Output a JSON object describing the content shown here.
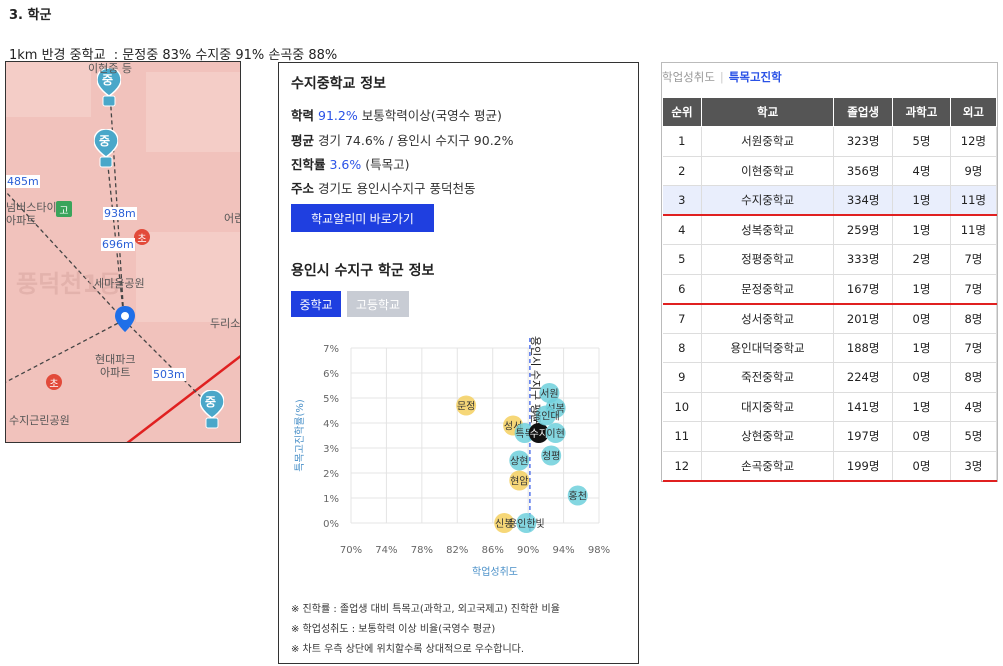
{
  "section_title": "3. 학군",
  "radius_summary": "1km 반경 중학교  : 문정중 83% 수지중 91% 손곡중 88%",
  "map": {
    "distances": [
      "485m",
      "938m",
      "696m",
      "503m"
    ],
    "labels": [
      "이현중 등",
      "아파트",
      "세마을공원",
      "풍덕천1동",
      "두리소",
      "현대파크",
      "아파트",
      "수지근린공원",
      "어린",
      "수지근린",
      "넘버스타이"
    ],
    "pin_labels": [
      "중",
      "중",
      "중"
    ],
    "badges": [
      "고",
      "초",
      "초"
    ],
    "icons": [
      "school-pin-icon",
      "location-pin-icon"
    ],
    "colors": {
      "area": "#f1c2bc",
      "road": "#e02020",
      "pin": "#4aa7c9",
      "location": "#1f6fe8"
    }
  },
  "school_info": {
    "title": "수지중학교 정보",
    "academic_label": "학력",
    "academic_value": "91.2%",
    "academic_note": "보통학력이상(국영수 평균)",
    "avg_label": "평균",
    "avg_value": "경기 74.6% / 용인시 수지구 90.2%",
    "advance_label": "진학률",
    "advance_value": "3.6%",
    "advance_note": "(특목고)",
    "address_label": "주소",
    "address_value": "경기도 용인시수지구 풍덕천동",
    "button": "학교알리미 바로가기"
  },
  "district": {
    "title": "용인시 수지구 학군 정보",
    "tabs": [
      "중학교",
      "고등학교"
    ],
    "active_tab": "중학교"
  },
  "chart_data": {
    "type": "scatter",
    "xlabel": "학업성취도",
    "ylabel": "특목고진학률(%)",
    "x_ticks": [
      "70%",
      "74%",
      "78%",
      "82%",
      "86%",
      "90%",
      "94%",
      "98%"
    ],
    "y_ticks": [
      "0%",
      "1%",
      "2%",
      "3%",
      "4%",
      "5%",
      "6%",
      "7%"
    ],
    "xlim": [
      70,
      98
    ],
    "ylim": [
      0,
      7
    ],
    "ref_line_label": "용인시 수지구 평균",
    "ref_line_x": 90.2,
    "points": [
      {
        "name": "문정",
        "x": 83.0,
        "y": 4.7,
        "color": "#f5d060"
      },
      {
        "name": "성서",
        "x": 88.3,
        "y": 3.9,
        "color": "#f5d060"
      },
      {
        "name": "현암",
        "x": 89.0,
        "y": 1.7,
        "color": "#f5d060"
      },
      {
        "name": "신봉",
        "x": 87.3,
        "y": 0.0,
        "color": "#f5d060"
      },
      {
        "name": "특목",
        "x": 89.6,
        "y": 3.6,
        "color": "#6fd0dc"
      },
      {
        "name": "수지",
        "x": 91.2,
        "y": 3.6,
        "color": "#111111"
      },
      {
        "name": "서원",
        "x": 92.4,
        "y": 5.2,
        "color": "#6fd0dc"
      },
      {
        "name": "성복",
        "x": 93.1,
        "y": 4.6,
        "color": "#6fd0dc"
      },
      {
        "name": "용인대",
        "x": 92.0,
        "y": 4.3,
        "color": "#6fd0dc"
      },
      {
        "name": "이현",
        "x": 93.1,
        "y": 3.6,
        "color": "#6fd0dc"
      },
      {
        "name": "청평",
        "x": 92.6,
        "y": 2.7,
        "color": "#6fd0dc"
      },
      {
        "name": "상현",
        "x": 89.0,
        "y": 2.5,
        "color": "#6fd0dc"
      },
      {
        "name": "홍천",
        "x": 95.6,
        "y": 1.1,
        "color": "#6fd0dc"
      },
      {
        "name": "용인한빛",
        "x": 89.8,
        "y": 0.0,
        "color": "#6fd0dc"
      }
    ]
  },
  "notes": [
    "※ 진학률 : 졸업생 대비 특목고(과학고, 외고국제고) 진학한 비율",
    "※ 학업성취도 : 보통학력 이상 비율(국영수 평균)",
    "※ 차트 우측 상단에 위치할수록 상대적으로 우수합니다."
  ],
  "ranking": {
    "tabs": [
      "학업성취도",
      "특목고진학"
    ],
    "active_tab": "특목고진학",
    "headers": [
      "순위",
      "학교",
      "졸업생",
      "과학고",
      "외고"
    ],
    "rows": [
      [
        "1",
        "서원중학교",
        "323명",
        "5명",
        "12명"
      ],
      [
        "2",
        "이현중학교",
        "356명",
        "4명",
        "9명"
      ],
      [
        "3",
        "수지중학교",
        "334명",
        "1명",
        "11명"
      ],
      [
        "4",
        "성복중학교",
        "259명",
        "1명",
        "11명"
      ],
      [
        "5",
        "정평중학교",
        "333명",
        "2명",
        "7명"
      ],
      [
        "6",
        "문정중학교",
        "167명",
        "1명",
        "7명"
      ],
      [
        "7",
        "성서중학교",
        "201명",
        "0명",
        "8명"
      ],
      [
        "8",
        "용인대덕중학교",
        "188명",
        "1명",
        "7명"
      ],
      [
        "9",
        "죽전중학교",
        "224명",
        "0명",
        "8명"
      ],
      [
        "10",
        "대지중학교",
        "141명",
        "1명",
        "4명"
      ],
      [
        "11",
        "상현중학교",
        "197명",
        "0명",
        "5명"
      ],
      [
        "12",
        "손곡중학교",
        "199명",
        "0명",
        "3명"
      ]
    ],
    "highlight_row": 2,
    "cut_rows": [
      2,
      5,
      11
    ]
  }
}
